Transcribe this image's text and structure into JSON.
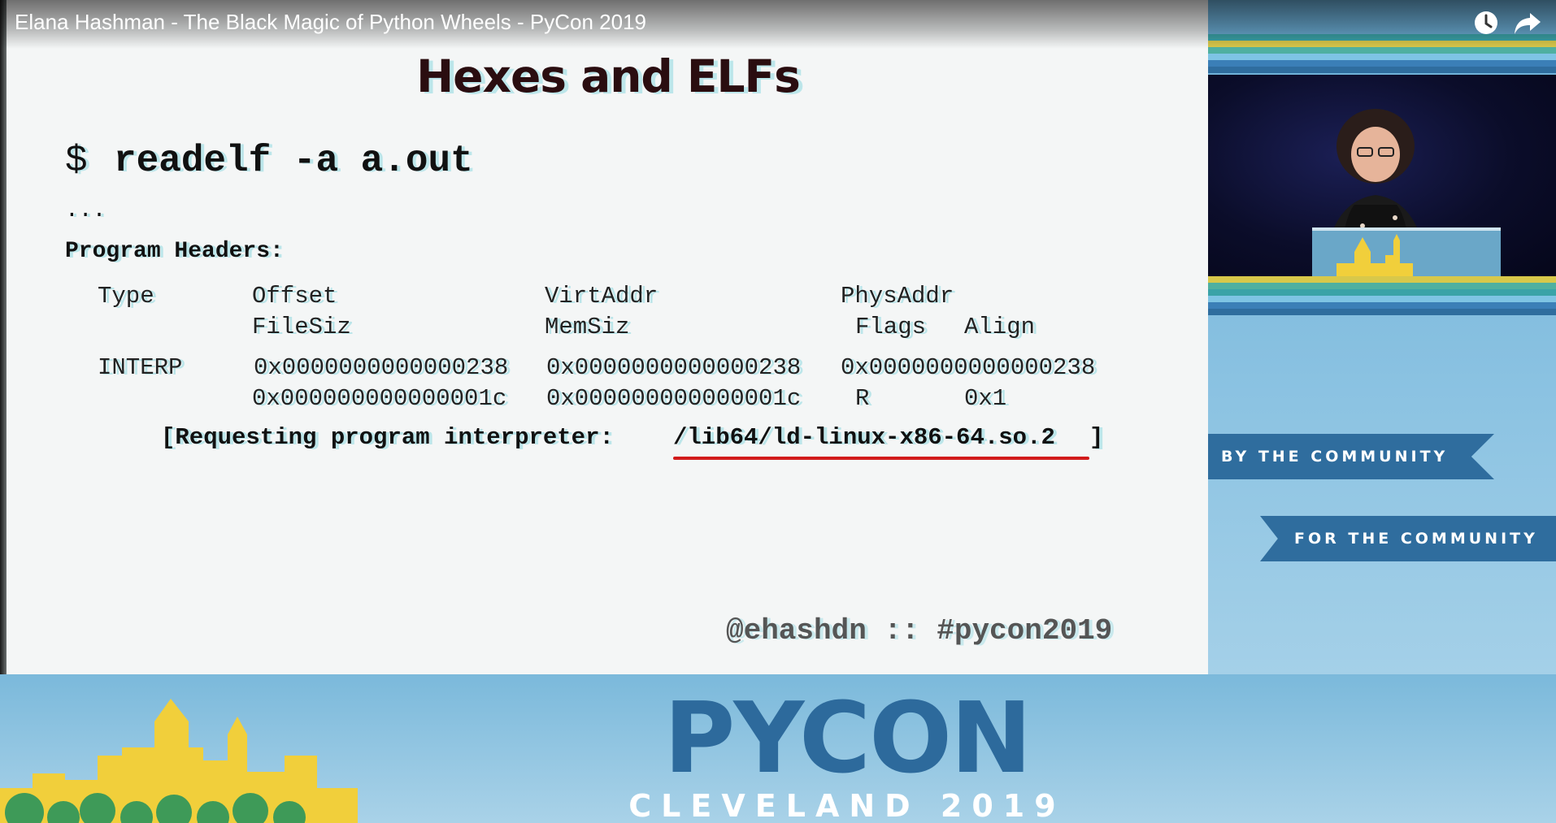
{
  "video": {
    "title": "Elana Hashman - The Black Magic of Python Wheels - PyCon 2019",
    "icons": [
      "clock-icon",
      "share-icon"
    ]
  },
  "slide": {
    "title": "Hexes and ELFs",
    "prompt": "$",
    "command": "readelf -a a.out",
    "ellipsis": "...",
    "program_headers_label": "Program Headers:",
    "columns": {
      "type": "Type",
      "offset": "Offset",
      "virtaddr": "VirtAddr",
      "physaddr": "PhysAddr",
      "filesiz": "FileSiz",
      "memsiz": "MemSiz",
      "flags": "Flags",
      "align": "Align"
    },
    "row": {
      "type": "INTERP",
      "offset": "0x0000000000000238",
      "virtaddr": "0x0000000000000238",
      "physaddr": "0x0000000000000238",
      "filesiz": "0x000000000000001c",
      "memsiz": "0x000000000000001c",
      "flags": "R",
      "align": "0x1"
    },
    "requesting_prefix": "[Requesting program interpreter: ",
    "interpreter_path": "/lib64/ld-linux-x86-64.so.2",
    "requesting_suffix": "]",
    "handle": "@ehashdn :: #pycon2019",
    "underline_color": "#d11b1b"
  },
  "side_panel": {
    "banner_by": "BY THE COMMUNITY",
    "banner_for": "FOR THE COMMUNITY"
  },
  "branding": {
    "logo": "PYCON",
    "subtitle": "CLEVELAND 2019",
    "logo_color": "#2d6a9c"
  }
}
